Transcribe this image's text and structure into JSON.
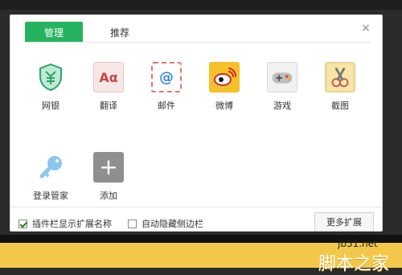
{
  "tabs": [
    {
      "label": "管理",
      "active": true
    },
    {
      "label": "推荐",
      "active": false
    }
  ],
  "items": [
    {
      "label": "网银",
      "icon": "shield-yen-icon"
    },
    {
      "label": "翻译",
      "icon": "translate-icon",
      "glyph": "Aα"
    },
    {
      "label": "邮件",
      "icon": "mail-icon",
      "glyph": "@"
    },
    {
      "label": "微博",
      "icon": "weibo-icon"
    },
    {
      "label": "游戏",
      "icon": "gamepad-icon"
    },
    {
      "label": "截图",
      "icon": "scissors-icon"
    },
    {
      "label": "登录管家",
      "icon": "key-icon"
    },
    {
      "label": "添加",
      "icon": "add-icon",
      "glyph": "+"
    }
  ],
  "options": [
    {
      "label": "插件栏显示扩展名称",
      "checked": true
    },
    {
      "label": "自动隐藏侧边栏",
      "checked": false
    }
  ],
  "more_button_label": "更多扩展",
  "watermark": {
    "site": "jb51.net",
    "brand": "脚本之家"
  },
  "colors": {
    "accent": "#26b35f"
  }
}
